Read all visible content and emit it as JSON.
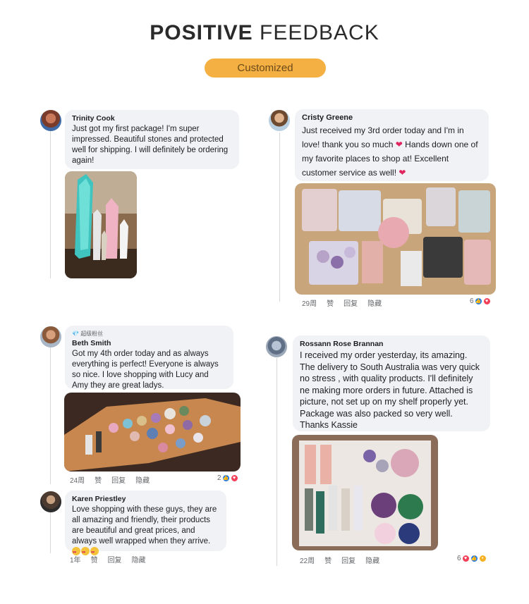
{
  "header": {
    "title_bold": "POSITIVE",
    "title_light": "FEEDBACK",
    "pill_label": "Customized"
  },
  "colors": {
    "pill": "#f5b043",
    "bubble": "#f0f2f5",
    "like": "#1877f2",
    "love": "#f33e58"
  },
  "reviews": [
    {
      "name": "Trinity Cook",
      "text": "Just got my first package! I'm super impressed. Beautiful stones and protected well for shipping. I will definitely be ordering again!"
    },
    {
      "name": "Cristy Greene",
      "text_a": "Just received my 3rd order today and I'm in love! thank you so much",
      "text_b": "Hands down one of my favorite places to shop at! Excellent customer service as well!",
      "meta": [
        "29周",
        "赞",
        "回复",
        "隐藏"
      ],
      "reactions": "6"
    },
    {
      "badge": "超级粉丝",
      "name": "Beth Smith",
      "text": "Got my 4th order today and as always everything is perfect! Everyone is always so nice. I love shopping with Lucy and Amy they are great ladys.",
      "meta": [
        "24周",
        "赞",
        "回复",
        "隐藏"
      ],
      "reactions": "2"
    },
    {
      "name": "Rossann Rose Brannan",
      "text": "I received my order yesterday, its amazing. The delivery to South Australia was very quick no stress , with quality products. I'll definitely ne making more orders in future. Attached is picture, not set up on my shelf properly yet. Package was also packed so very well. Thanks Kassie",
      "meta": [
        "22周",
        "赞",
        "回复",
        "隐藏"
      ],
      "reactions": "6"
    },
    {
      "name": "Karen Priestley",
      "text": "Love shopping with these guys, they are all amazing and friendly, their products are beautiful and great prices, and always well wrapped when they arrive.",
      "meta": [
        "1年",
        "赞",
        "回复",
        "隐藏"
      ]
    }
  ]
}
